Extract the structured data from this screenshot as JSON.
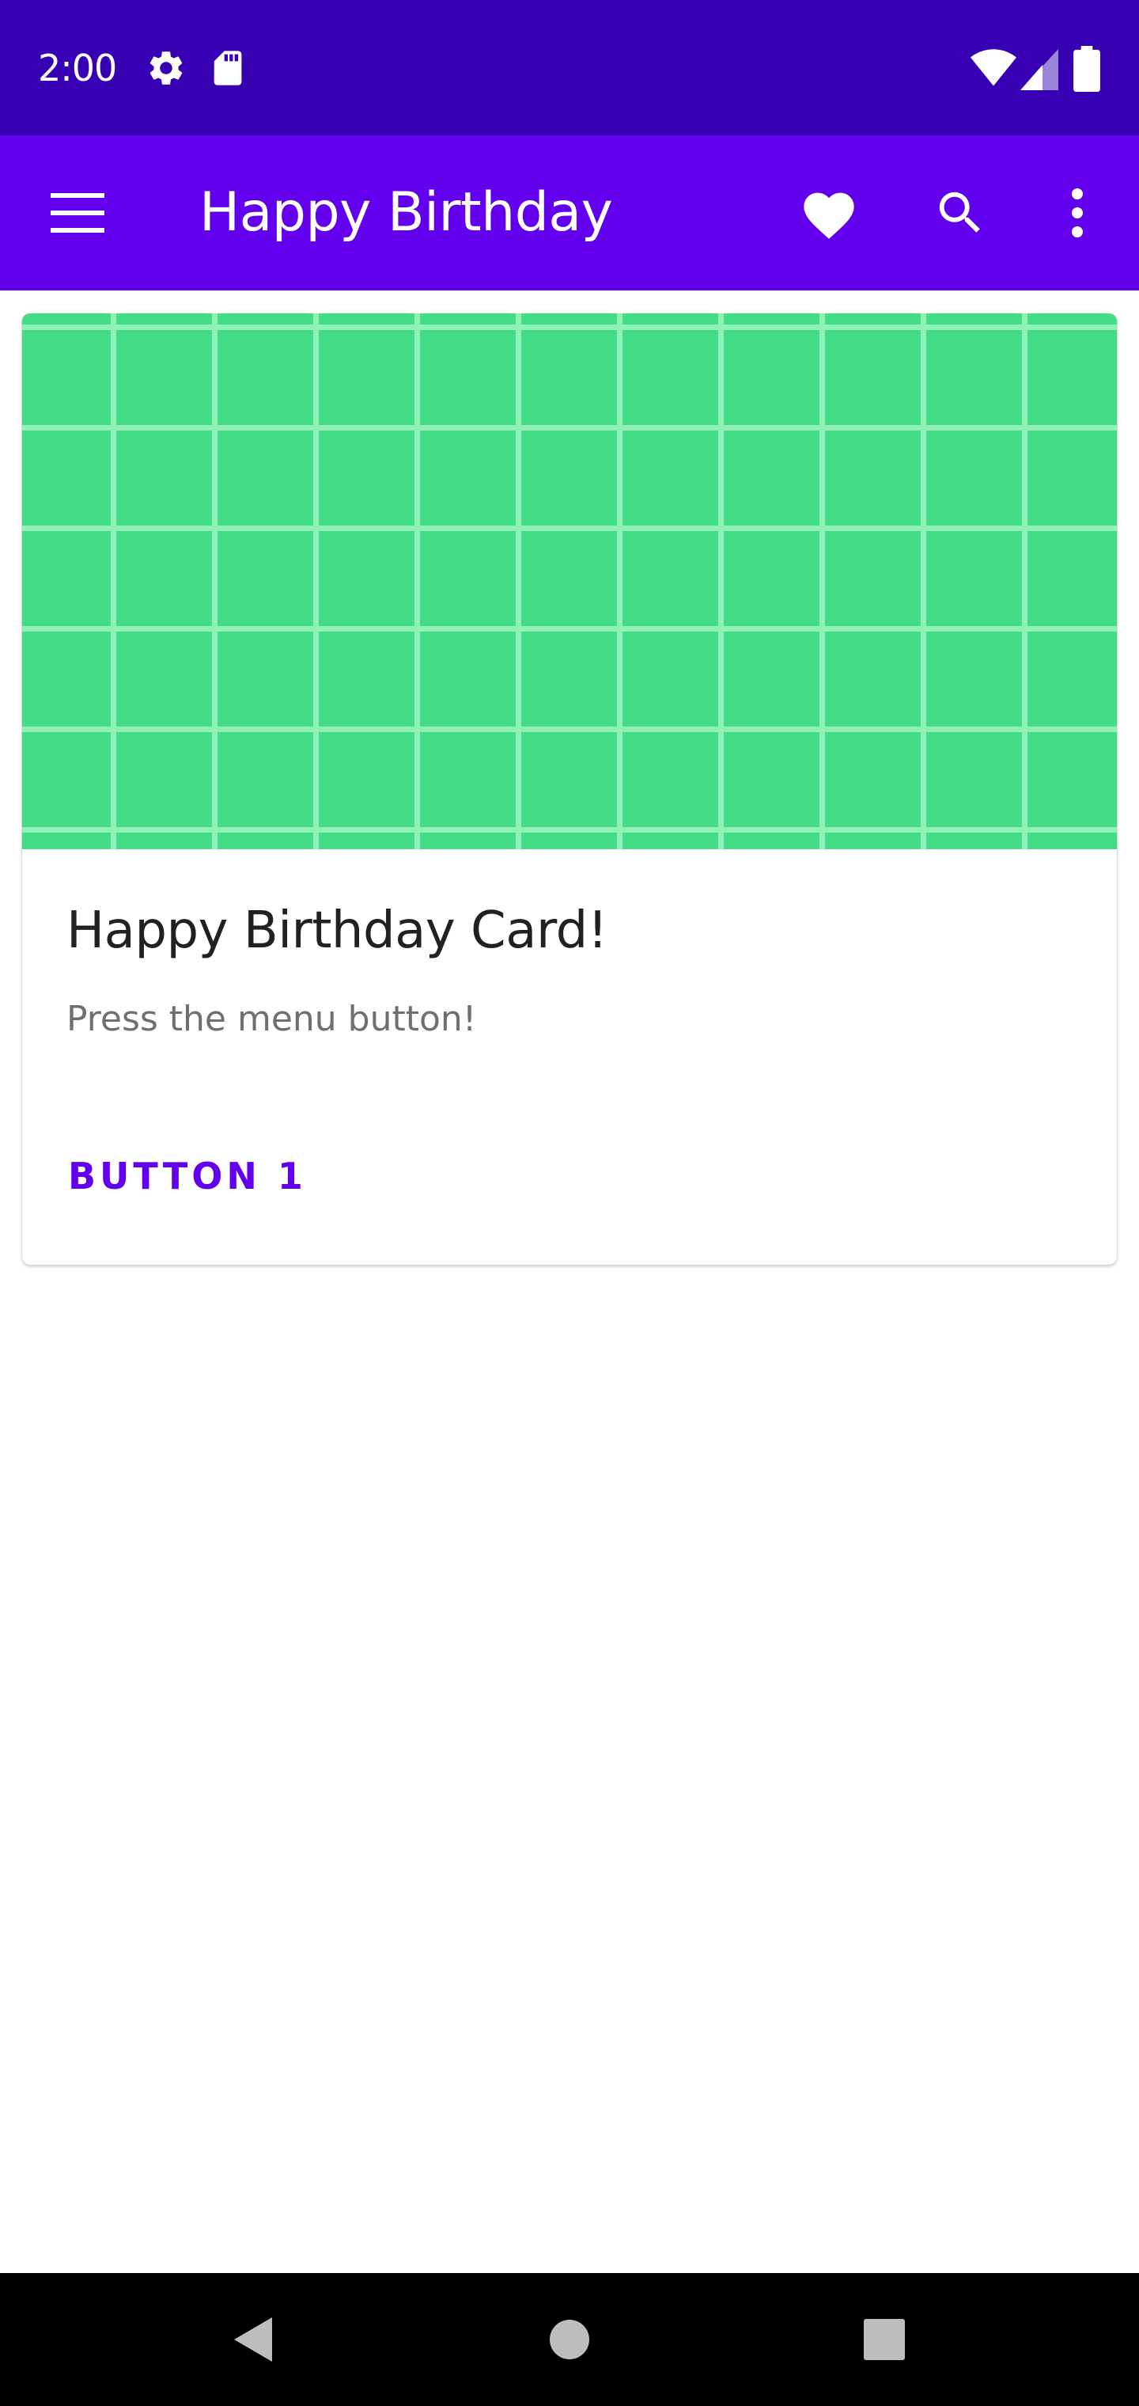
{
  "status_bar": {
    "time": "2:00",
    "icons": [
      "gear-icon",
      "sd-card-icon",
      "wifi-icon",
      "cell-signal-icon",
      "battery-icon"
    ]
  },
  "app_bar": {
    "title": "Happy Birthday",
    "icons": [
      "menu-icon",
      "heart-icon",
      "search-icon",
      "more-vert-icon"
    ]
  },
  "card": {
    "title": "Happy Birthday Card!",
    "subtitle": "Press the menu button!",
    "button_label": "BUTTON 1"
  },
  "nav_bar": {
    "icons": [
      "back-icon",
      "home-icon",
      "recents-icon"
    ]
  },
  "colors": {
    "status_bar": "#3700b3",
    "primary": "#6200ee",
    "card_media": "#41dc85",
    "grid_lines": "#8ff0b8",
    "title_text": "#212121",
    "secondary_text": "#6f6f6f"
  }
}
